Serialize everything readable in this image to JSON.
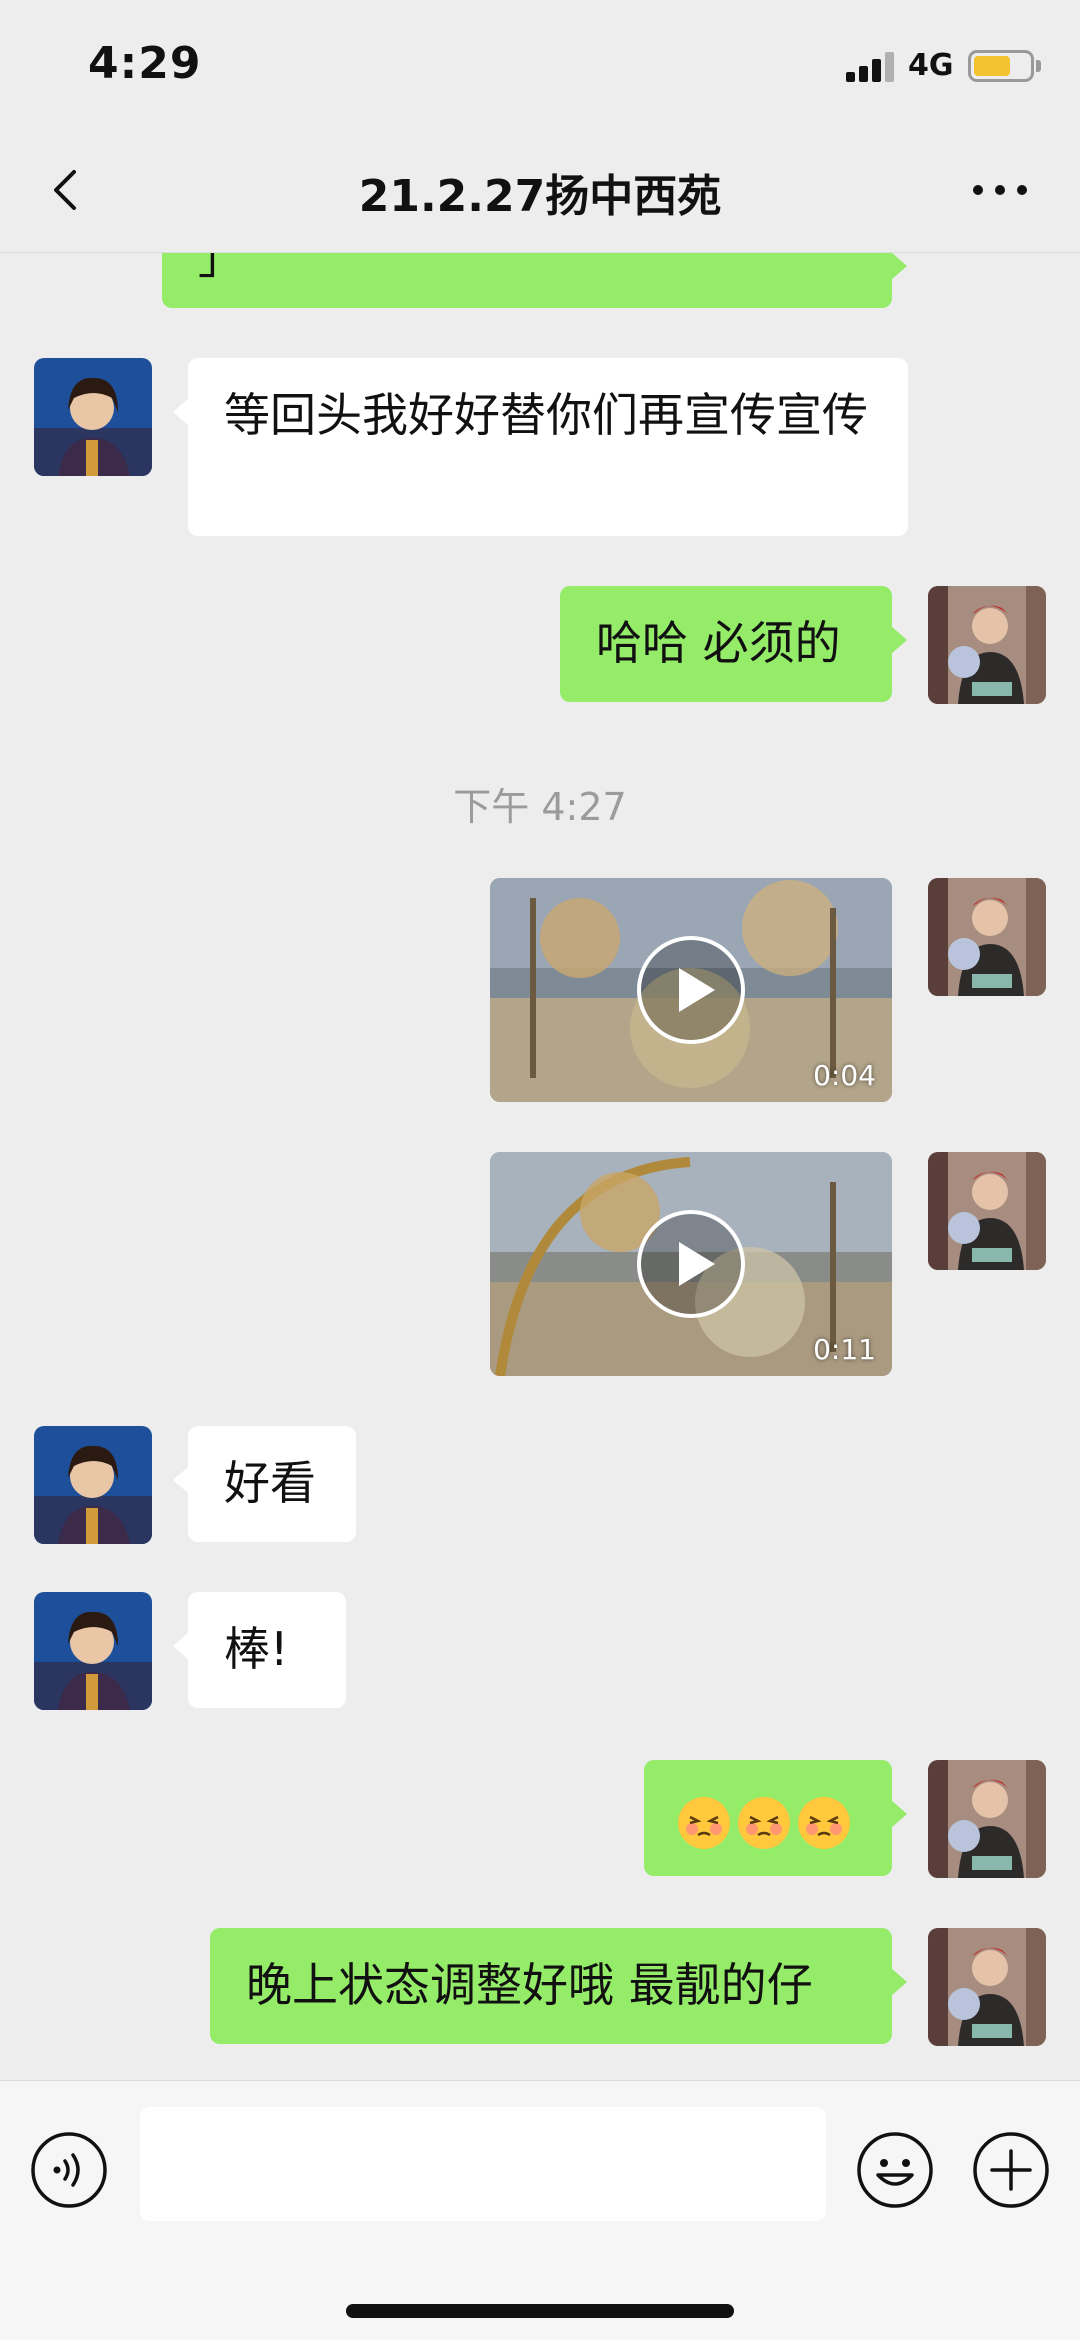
{
  "status_bar": {
    "time": "4:29",
    "network": "4G",
    "battery_level": 0.6,
    "signal_bars": 3
  },
  "nav": {
    "title": "21.2.27扬中西苑",
    "back_icon": "chevron-left-icon",
    "more_icon": "more-dots-icon"
  },
  "messages": [
    {
      "side": "out",
      "type": "text",
      "text": "」"
    },
    {
      "side": "in",
      "type": "text",
      "text": "等回头我好好替你们再宣传宣传"
    },
    {
      "side": "out",
      "type": "text",
      "text": "哈哈 必须的"
    },
    {
      "type": "timestamp",
      "text": "下午 4:27"
    },
    {
      "side": "out",
      "type": "video",
      "duration": "0:04"
    },
    {
      "side": "out",
      "type": "video",
      "duration": "0:11"
    },
    {
      "side": "in",
      "type": "text",
      "text": "好看"
    },
    {
      "side": "in",
      "type": "text",
      "text": "棒!"
    },
    {
      "side": "out",
      "type": "emoji",
      "emoji": [
        "embarrassed-face-emoji",
        "embarrassed-face-emoji",
        "embarrassed-face-emoji"
      ]
    },
    {
      "side": "out",
      "type": "text",
      "text": "晚上状态调整好哦 最靓的仔"
    }
  ],
  "input_bar": {
    "voice_icon": "voice-icon",
    "emoji_icon": "smiley-icon",
    "plus_icon": "plus-icon",
    "placeholder": ""
  },
  "colors": {
    "background": "#ededed",
    "outgoing_bubble": "#95ec69",
    "incoming_bubble": "#ffffff",
    "timestamp": "#9b9b9b"
  }
}
